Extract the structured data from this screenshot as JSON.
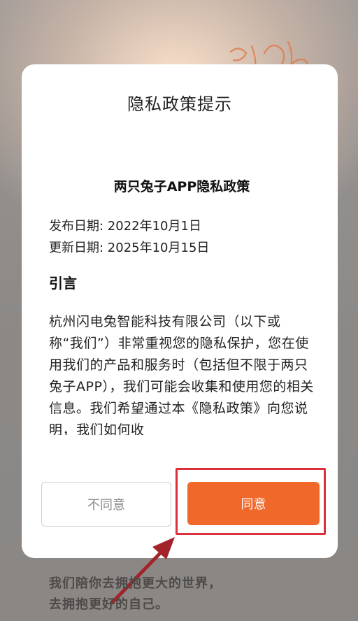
{
  "dialog": {
    "title": "隐私政策提示",
    "doc_title": "两只兔子APP隐私政策",
    "publish_date": "发布日期: 2022年10月1日",
    "update_date": "更新日期: 2025年10月15日",
    "section_title": "引言",
    "paragraph": "杭州闪电兔智能科技有限公司（以下或称“我们”）非常重视您的隐私保护，您在使用我们的产品和服务时（包括但不限于两只兔子APP），我们可能会收集和使用您的相关信息。我们希望通过本《隐私政策》向您说明，我们如何收",
    "decline_label": "不同意",
    "agree_label": "同意"
  },
  "background": {
    "slogan_line1": "我们陪你去拥抱更大的世界，",
    "slogan_line2": "去拥抱更好的自己。"
  },
  "colors": {
    "accent": "#f0692b",
    "annotation_red": "#d9303a",
    "annotation_arrow": "#a3232b"
  }
}
